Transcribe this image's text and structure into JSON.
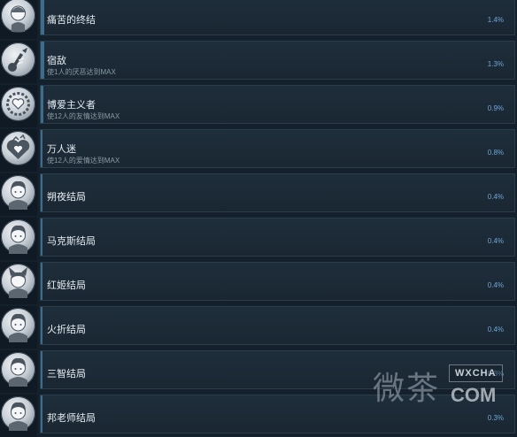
{
  "achievements": [
    {
      "title": "痛苦的终结",
      "desc": "",
      "percent": "1.4%",
      "fill": 0.014,
      "icon": "masked-face-icon"
    },
    {
      "title": "宿敌",
      "desc": "使1人的厌恶达到MAX",
      "percent": "1.3%",
      "fill": 0.013,
      "icon": "broken-guitar-icon"
    },
    {
      "title": "博爱主义者",
      "desc": "使12人的友情达到MAX",
      "percent": "0.9%",
      "fill": 0.009,
      "icon": "heart-wreath-icon"
    },
    {
      "title": "万人迷",
      "desc": "使12人的爱情达到MAX",
      "percent": "0.8%",
      "fill": 0.008,
      "icon": "heart-pile-icon"
    },
    {
      "title": "朔夜结局",
      "desc": "",
      "percent": "0.4%",
      "fill": 0.004,
      "icon": "character-portrait-icon"
    },
    {
      "title": "马克斯结局",
      "desc": "",
      "percent": "0.4%",
      "fill": 0.004,
      "icon": "character-portrait-icon"
    },
    {
      "title": "红姬结局",
      "desc": "",
      "percent": "0.4%",
      "fill": 0.004,
      "icon": "fox-girl-portrait-icon"
    },
    {
      "title": "火折结局",
      "desc": "",
      "percent": "0.4%",
      "fill": 0.004,
      "icon": "character-portrait-icon"
    },
    {
      "title": "三智结局",
      "desc": "",
      "percent": "0.3%",
      "fill": 0.003,
      "icon": "character-portrait-icon"
    },
    {
      "title": "邦老师结局",
      "desc": "",
      "percent": "0.3%",
      "fill": 0.003,
      "icon": "character-portrait-icon"
    }
  ],
  "watermark": {
    "main": "微茶",
    "badge": "WXCHA",
    "com": "COM"
  },
  "colors": {
    "background": "#14202b",
    "row": "#1d2b37",
    "fill": "#3d6c8d",
    "percent": "#6fa6d6"
  }
}
